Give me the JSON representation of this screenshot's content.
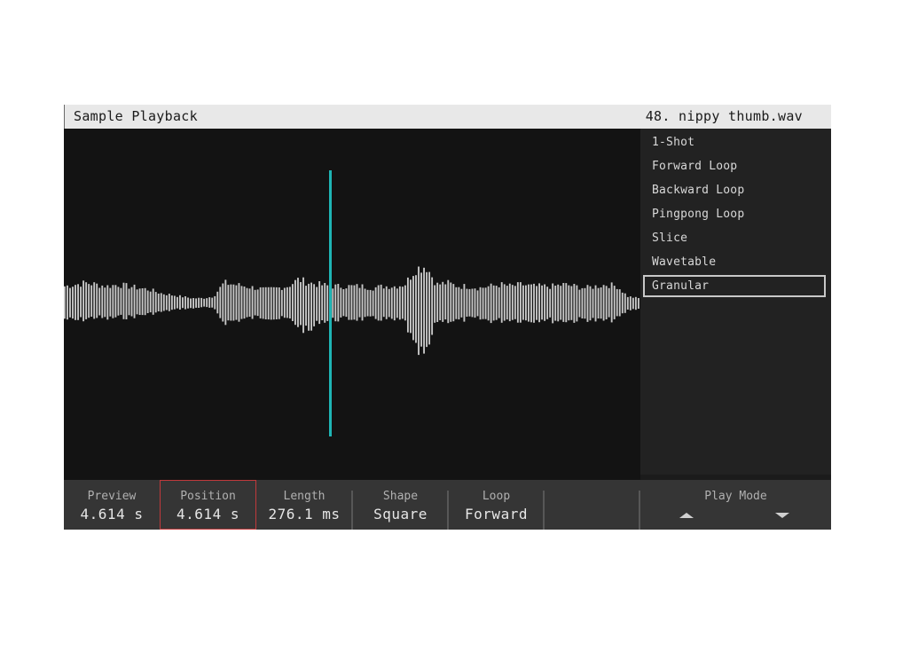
{
  "header": {
    "title": "Sample Playback",
    "filename": "48. nippy thumb.wav"
  },
  "waveform": {
    "color": "#c8c8c8",
    "playhead_color": "#1fb5b5",
    "playhead_position_fraction": 0.46,
    "envelope": [
      [
        0.1,
        0.09
      ],
      [
        0.11,
        0.1
      ],
      [
        0.12,
        0.09
      ],
      [
        0.11,
        0.08
      ],
      [
        0.1,
        0.09
      ],
      [
        0.11,
        0.08
      ],
      [
        0.1,
        0.08
      ],
      [
        0.09,
        0.07
      ],
      [
        0.08,
        0.06
      ],
      [
        0.06,
        0.05
      ],
      [
        0.05,
        0.04
      ],
      [
        0.04,
        0.03
      ],
      [
        0.03,
        0.03
      ],
      [
        0.03,
        0.02
      ],
      [
        0.04,
        0.03
      ],
      [
        0.12,
        0.11
      ],
      [
        0.11,
        0.1
      ],
      [
        0.1,
        0.09
      ],
      [
        0.09,
        0.08
      ],
      [
        0.08,
        0.08
      ],
      [
        0.09,
        0.09
      ],
      [
        0.1,
        0.09
      ],
      [
        0.14,
        0.13
      ],
      [
        0.12,
        0.17
      ],
      [
        0.11,
        0.1
      ],
      [
        0.1,
        0.1
      ],
      [
        0.1,
        0.09
      ],
      [
        0.1,
        0.09
      ],
      [
        0.1,
        0.09
      ],
      [
        0.09,
        0.09
      ],
      [
        0.1,
        0.09
      ],
      [
        0.1,
        0.1
      ],
      [
        0.11,
        0.1
      ],
      [
        0.2,
        0.28
      ],
      [
        0.22,
        0.31
      ],
      [
        0.11,
        0.1
      ],
      [
        0.12,
        0.1
      ],
      [
        0.1,
        0.1
      ],
      [
        0.1,
        0.09
      ],
      [
        0.09,
        0.09
      ],
      [
        0.1,
        0.1
      ],
      [
        0.11,
        0.1
      ],
      [
        0.1,
        0.09
      ],
      [
        0.11,
        0.1
      ],
      [
        0.1,
        0.1
      ],
      [
        0.1,
        0.09
      ],
      [
        0.1,
        0.1
      ],
      [
        0.11,
        0.1
      ],
      [
        0.1,
        0.1
      ],
      [
        0.09,
        0.09
      ],
      [
        0.1,
        0.1
      ],
      [
        0.11,
        0.1
      ],
      [
        0.1,
        0.09
      ],
      [
        0.04,
        0.04
      ],
      [
        0.03,
        0.03
      ]
    ]
  },
  "play_modes": {
    "items": [
      "1-Shot",
      "Forward Loop",
      "Backward Loop",
      "Pingpong Loop",
      "Slice",
      "Wavetable",
      "Granular"
    ],
    "selected_index": 6
  },
  "params": [
    {
      "label": "Preview",
      "value": "4.614 s"
    },
    {
      "label": "Position",
      "value": "4.614 s",
      "highlighted": true
    },
    {
      "label": "Length",
      "value": "276.1 ms"
    },
    {
      "label": "Shape",
      "value": "Square"
    },
    {
      "label": "Loop",
      "value": "Forward"
    },
    {
      "label": "",
      "value": ""
    }
  ],
  "play_mode_control": {
    "label": "Play Mode",
    "up_icon": "triangle-up",
    "down_icon": "triangle-down"
  },
  "colors": {
    "highlight_border": "#c0393b",
    "background": "#131313",
    "panel": "#222222",
    "bottom_bar": "#353535"
  }
}
